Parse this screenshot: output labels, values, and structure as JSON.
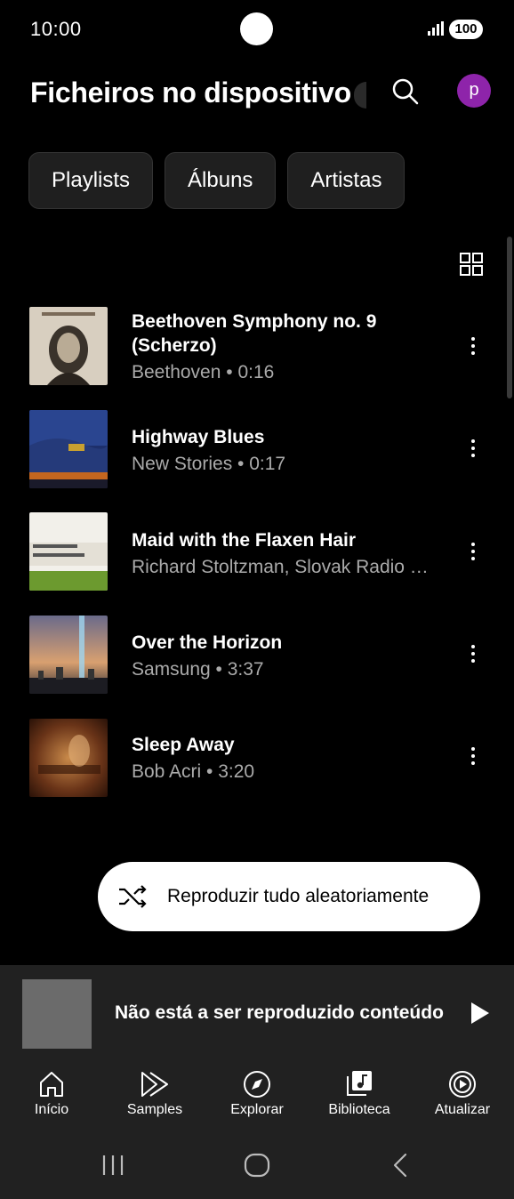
{
  "status_bar": {
    "time": "10:00",
    "battery": "100"
  },
  "header": {
    "title": "Ficheiros no dispositivo",
    "avatar_letter": "p",
    "avatar_color": "#8e24aa"
  },
  "chips": [
    {
      "label": "Playlists"
    },
    {
      "label": "Álbuns"
    },
    {
      "label": "Artistas"
    }
  ],
  "tracks": [
    {
      "title": "Beethoven Symphony no. 9",
      "title2": "(Scherzo)",
      "subtitle": "Beethoven • 0:16"
    },
    {
      "title": "Highway Blues",
      "subtitle": "New Stories • 0:17"
    },
    {
      "title": "Maid with the Flaxen Hair",
      "subtitle": "Richard Stoltzman, Slovak Radio …"
    },
    {
      "title": "Over the Horizon",
      "subtitle": "Samsung • 3:37"
    },
    {
      "title": "Sleep Away",
      "subtitle": "Bob Acri • 3:20"
    }
  ],
  "shuffle": {
    "label": "Reproduzir tudo aleatoriamente"
  },
  "mini_player": {
    "text": "Não está a ser reproduzido conteúdo"
  },
  "bottom_nav": [
    {
      "label": "Início",
      "icon": "home-icon"
    },
    {
      "label": "Samples",
      "icon": "samples-icon"
    },
    {
      "label": "Explorar",
      "icon": "compass-icon"
    },
    {
      "label": "Biblioteca",
      "icon": "library-icon"
    },
    {
      "label": "Atualizar",
      "icon": "upgrade-icon"
    }
  ],
  "colors": {
    "background": "#000000",
    "surface": "#212121",
    "chip": "#1f1f1f",
    "secondary_text": "#aaaaaa"
  }
}
